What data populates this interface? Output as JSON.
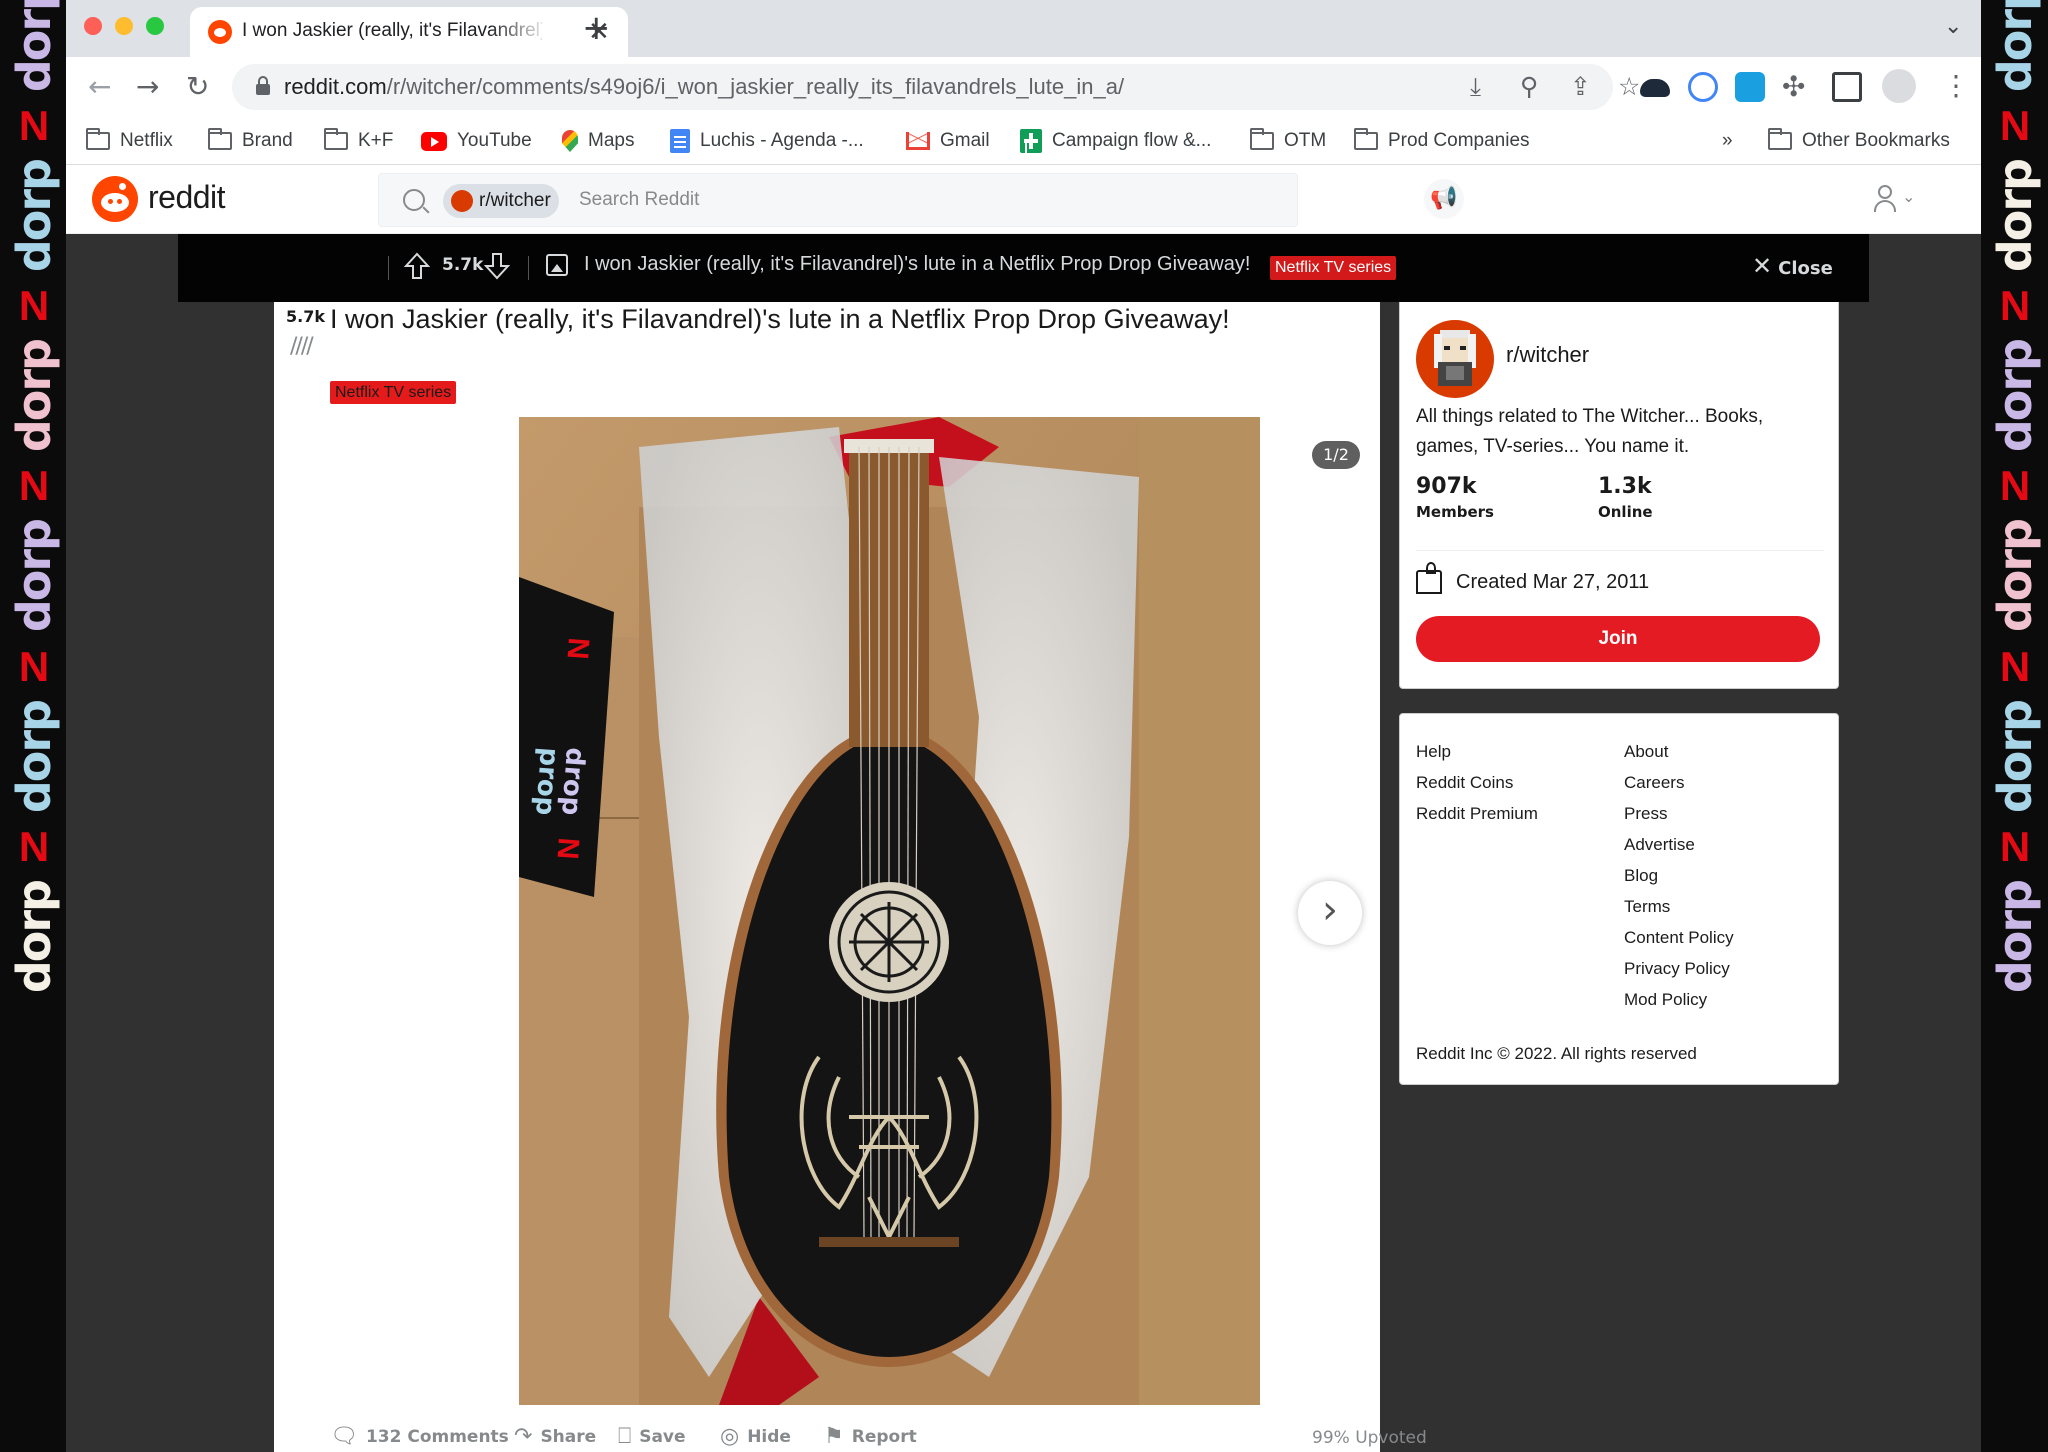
{
  "browser": {
    "tab_title": "I won Jaskier (really, it's Filavandrel)'s lute in a Netflix Prop Drop Giveaway!",
    "new_tab_symbol": "+",
    "url_host": "reddit.com",
    "url_path": "/r/witcher/comments/s49oj6/i_won_jaskier_really_its_filavandrels_lute_in_a/",
    "bookmarks": [
      {
        "label": "Netflix",
        "icon": "folder-icon"
      },
      {
        "label": "Brand",
        "icon": "folder-icon"
      },
      {
        "label": "K+F",
        "icon": "folder-icon"
      },
      {
        "label": "YouTube",
        "icon": "youtube-icon"
      },
      {
        "label": "Maps",
        "icon": "maps-icon"
      },
      {
        "label": "Luchis - Agenda -...",
        "icon": "docs-icon"
      },
      {
        "label": "Gmail",
        "icon": "gmail-icon"
      },
      {
        "label": "Campaign flow &...",
        "icon": "sheets-icon"
      },
      {
        "label": "OTM",
        "icon": "folder-icon"
      },
      {
        "label": "Prod Companies",
        "icon": "folder-icon"
      }
    ],
    "bookmarks_overflow": "»",
    "other_bookmarks": "Other Bookmarks"
  },
  "reddit": {
    "logo_text": "reddit",
    "search_chip": "r/witcher",
    "search_placeholder": "Search Reddit"
  },
  "postbar": {
    "score": "5.7k",
    "title": "I won Jaskier (really, it's Filavandrel)'s lute in a Netflix Prop Drop Giveaway!",
    "flair": "Netflix TV series",
    "close_label": "Close"
  },
  "post": {
    "score": "5.7k",
    "title": "I won Jaskier (really, it's Filavandrel)'s lute in a Netflix Prop Drop Giveaway!",
    "flair": "Netflix TV series",
    "gallery_counter": "1/2",
    "actions": {
      "comments": "132 Comments",
      "share": "Share",
      "save": "Save",
      "hide": "Hide",
      "report": "Report"
    },
    "upvoted": "99% Upvoted"
  },
  "photo_strip_text": [
    "drop",
    "prop",
    "drop",
    "prop"
  ],
  "about": {
    "name": "r/witcher",
    "description": "All things related to The Witcher... Books, games, TV-series... You name it.",
    "members_value": "907k",
    "members_label": "Members",
    "online_value": "1.3k",
    "online_label": "Online",
    "created": "Created Mar 27, 2011",
    "join_label": "Join"
  },
  "footer": {
    "col1": [
      "Help",
      "Reddit Coins",
      "Reddit Premium"
    ],
    "col2": [
      "About",
      "Careers",
      "Press",
      "Advertise",
      "Blog",
      "Terms",
      "Content Policy",
      "Privacy Policy",
      "Mod Policy"
    ],
    "copyright": "Reddit Inc © 2022. All rights reserved"
  },
  "colors": {
    "reddit_orange": "#ff4500",
    "join_red": "#e51b23",
    "flair_red": "#e51b1b",
    "postbar_black": "#030303",
    "page_dark": "#313131"
  }
}
